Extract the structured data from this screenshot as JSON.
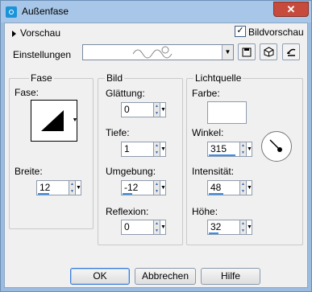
{
  "window": {
    "title": "Außenfase"
  },
  "header": {
    "preview_toggle": "Vorschau",
    "image_preview_label": "Bildvorschau",
    "image_preview_checked": true,
    "settings_label": "Einstellungen",
    "preset_value": ""
  },
  "bevel": {
    "group_title": "Fase",
    "bevel_label": "Fase:",
    "width_label": "Breite:",
    "width_value": "12"
  },
  "image": {
    "group_title": "Bild",
    "smoothness_label": "Glättung:",
    "smoothness_value": "0",
    "depth_label": "Tiefe:",
    "depth_value": "1",
    "ambience_label": "Umgebung:",
    "ambience_value": "-12",
    "shininess_label": "Reflexion:",
    "shininess_value": "0"
  },
  "light": {
    "group_title": "Lichtquelle",
    "color_label": "Farbe:",
    "color_value": "#ffffff",
    "angle_label": "Winkel:",
    "angle_value": "315",
    "intensity_label": "Intensität:",
    "intensity_value": "48",
    "elevation_label": "Höhe:",
    "elevation_value": "32"
  },
  "buttons": {
    "ok": "OK",
    "cancel": "Abbrechen",
    "help": "Hilfe"
  }
}
